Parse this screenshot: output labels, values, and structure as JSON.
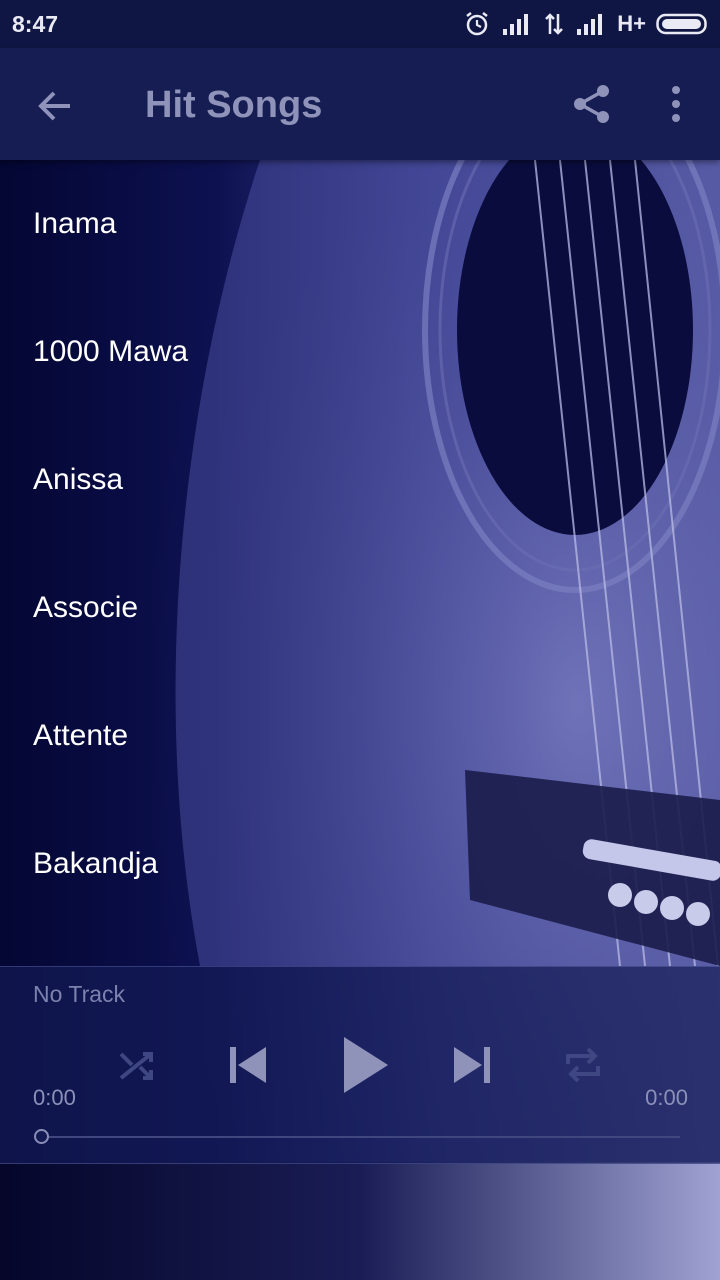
{
  "status_bar": {
    "time": "8:47",
    "network": "H+"
  },
  "app_bar": {
    "title": "Hit Songs"
  },
  "songs": [
    "Inama",
    "1000 Mawa",
    "Anissa",
    "Associe",
    "Attente",
    "Bakandja"
  ],
  "player": {
    "track": "No Track",
    "current_time": "0:00",
    "total_time": "0:00",
    "progress": 0
  },
  "icons": {
    "back": "arrow-back-icon",
    "share": "share-icon",
    "more": "more-vert-icon",
    "shuffle": "shuffle-icon",
    "previous": "skip-previous-icon",
    "play": "play-icon",
    "next": "skip-next-icon",
    "repeat": "repeat-icon"
  },
  "colors": {
    "app_bar": "#151d52",
    "status_bar": "#101644",
    "accent": "#8f92b9"
  }
}
